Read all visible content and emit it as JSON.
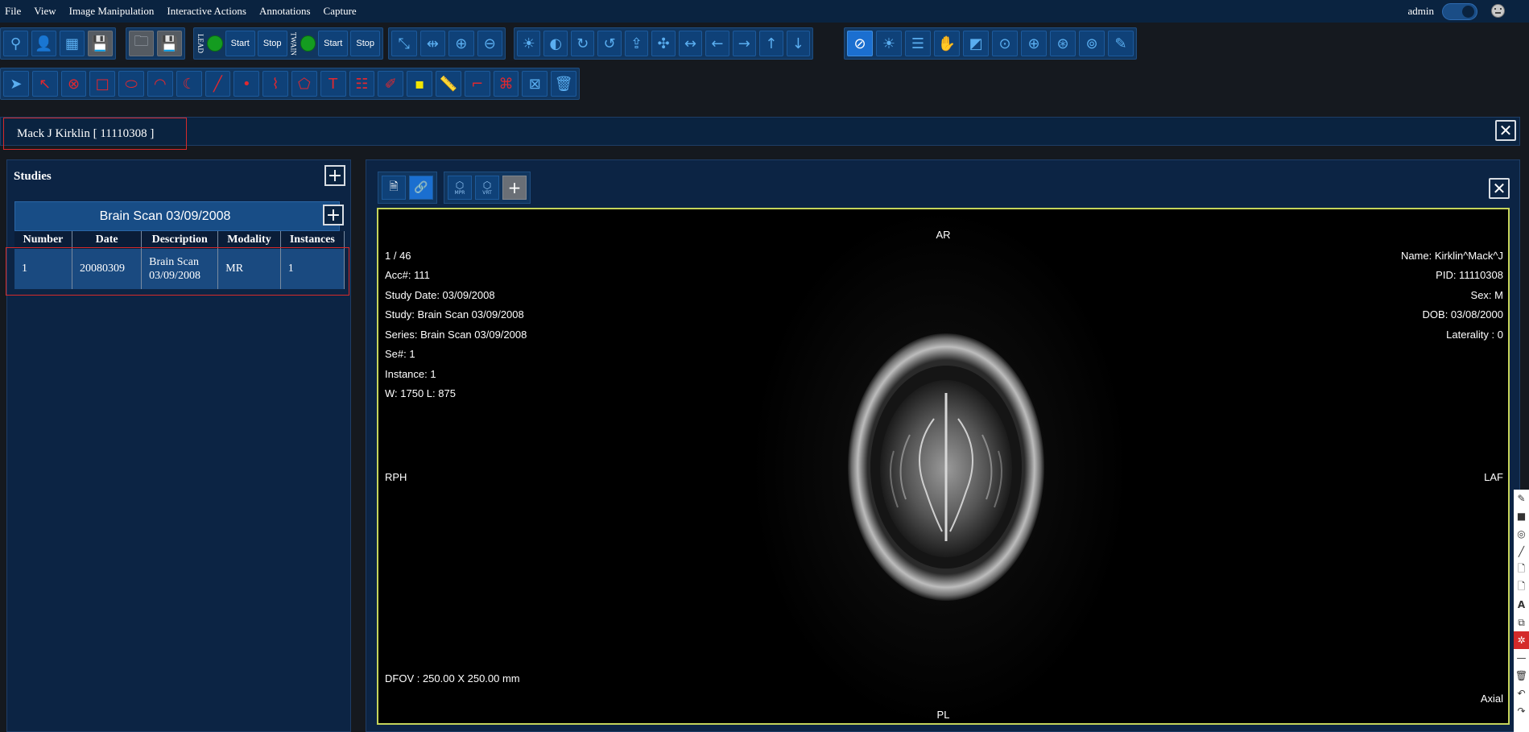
{
  "menu": {
    "items": [
      "File",
      "View",
      "Image Manipulation",
      "Interactive Actions",
      "Annotations",
      "Capture"
    ],
    "user": "admin"
  },
  "toolbar": {
    "lead_label": "LEAD",
    "twain_label": "TWAIN",
    "start_label": "Start",
    "stop_label": "Stop"
  },
  "patient": {
    "header": "Mack J Kirklin [ 11110308 ]"
  },
  "studies": {
    "title": "Studies",
    "study_name": "Brain Scan 03/09/2008",
    "columns": [
      "Number",
      "Date",
      "Description",
      "Modality",
      "Instances"
    ],
    "rows": [
      {
        "number": "1",
        "date": "20080309",
        "description_line1": "Brain Scan",
        "description_line2": "03/09/2008",
        "modality": "MR",
        "instances": "1"
      }
    ]
  },
  "viewer": {
    "mpr_label": "MPR",
    "vrt_label": "VRT",
    "overlay": {
      "top_center": "AR",
      "bottom_center": "PL",
      "left_center": "RPH",
      "right_center": "LAF",
      "left_lines": [
        "1 / 46",
        "Acc#: 111",
        "Study Date: 03/09/2008",
        "Study: Brain Scan 03/09/2008",
        "Series: Brain Scan 03/09/2008",
        "Se#: 1",
        "Instance: 1",
        "W: 1750 L: 875"
      ],
      "right_lines": [
        "Name: Kirklin^Mack^J",
        "PID: 11110308",
        "Sex: M",
        "DOB: 03/08/2000",
        "Laterality : 0"
      ],
      "dfov": "DFOV : 250.00 X 250.00 mm",
      "orientation": "Axial"
    }
  },
  "colors": {
    "menubar": "#0a2340",
    "button": "#0f4178",
    "accent": "#1b6fd0",
    "highlight_border": "#d62a2a",
    "viewport_border": "#c5d45a",
    "led": "#149c20"
  }
}
